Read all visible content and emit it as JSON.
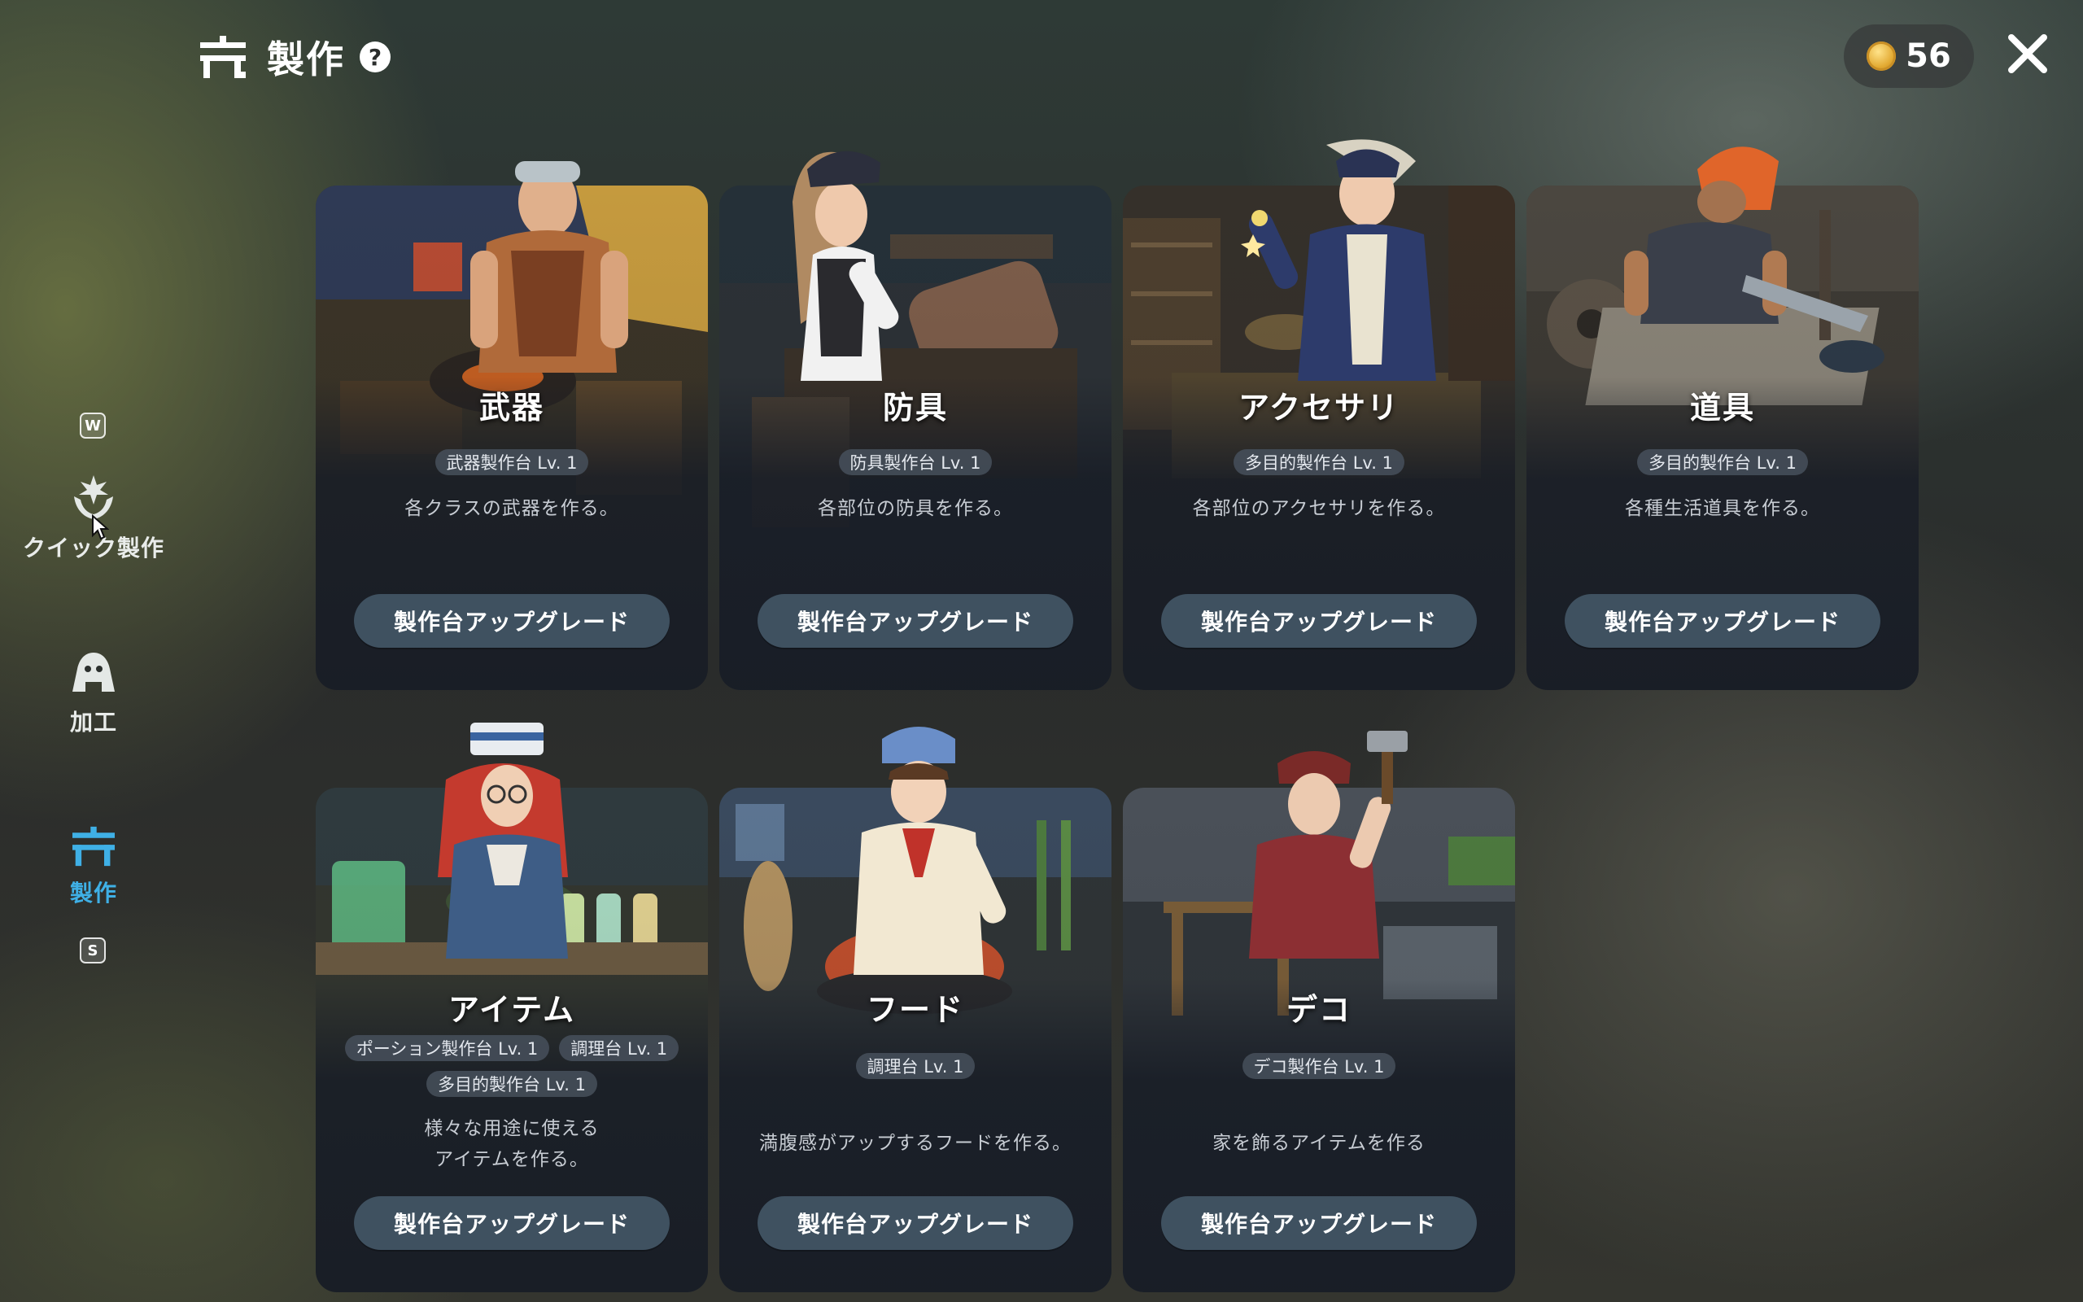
{
  "header": {
    "title": "製作",
    "help": "?"
  },
  "currency": {
    "amount": "56"
  },
  "nav": {
    "quick_key": "W",
    "quick_label": "クイック製作",
    "process_label": "加工",
    "craft_label": "製作",
    "craft_key": "S"
  },
  "cards": [
    {
      "title": "武器",
      "reqs": [
        "武器製作台 Lv. 1"
      ],
      "desc": "各クラスの武器を作る。",
      "button": "製作台アップグレード"
    },
    {
      "title": "防具",
      "reqs": [
        "防具製作台 Lv. 1"
      ],
      "desc": "各部位の防具を作る。",
      "button": "製作台アップグレード"
    },
    {
      "title": "アクセサリ",
      "reqs": [
        "多目的製作台 Lv. 1"
      ],
      "desc": "各部位のアクセサリを作る。",
      "button": "製作台アップグレード"
    },
    {
      "title": "道具",
      "reqs": [
        "多目的製作台 Lv. 1"
      ],
      "desc": "各種生活道具を作る。",
      "button": "製作台アップグレード"
    },
    {
      "title": "アイテム",
      "reqs": [
        "ポーション製作台 Lv. 1",
        "調理台 Lv. 1",
        "多目的製作台 Lv. 1"
      ],
      "desc_line1": "様々な用途に使える",
      "desc_line2": "アイテムを作る。",
      "button": "製作台アップグレード"
    },
    {
      "title": "フード",
      "reqs": [
        "調理台 Lv. 1"
      ],
      "desc": "満腹感がアップするフードを作る。",
      "button": "製作台アップグレード"
    },
    {
      "title": "デコ",
      "reqs": [
        "デコ製作台 Lv. 1"
      ],
      "desc": "家を飾るアイテムを作る",
      "button": "製作台アップグレード"
    }
  ],
  "colors": {
    "accent": "#3fb0e6",
    "button": "#3f5160",
    "card_dark": "#181d26"
  }
}
